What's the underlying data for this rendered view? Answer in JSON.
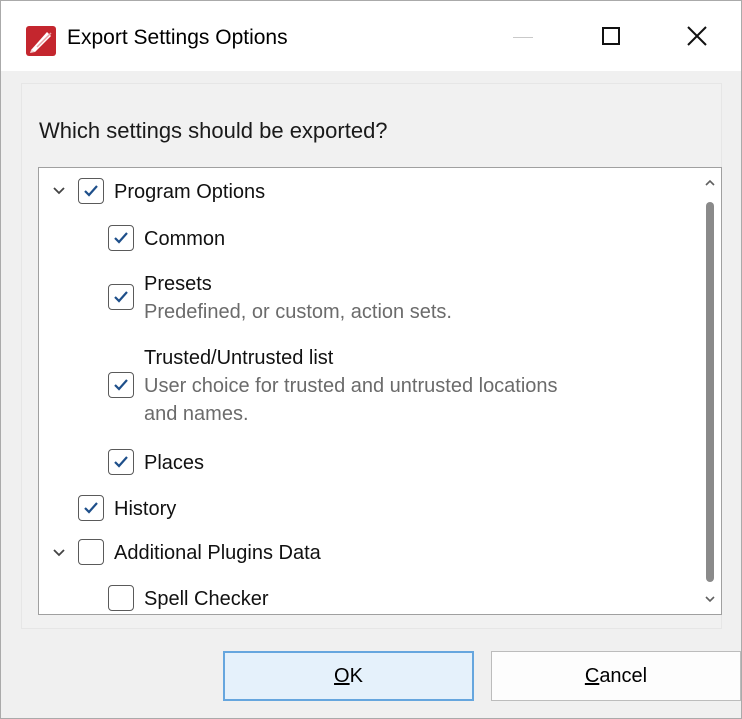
{
  "window": {
    "title": "Export Settings Options",
    "icons": {
      "app": "pdf-editor-app-icon",
      "minimize": "minimize-icon",
      "maximize": "maximize-icon",
      "close": "close-icon"
    }
  },
  "prompt": "Which settings should be exported?",
  "tree": {
    "program_options": {
      "label": "Program Options",
      "checked": true,
      "expanded": true
    },
    "common": {
      "label": "Common",
      "checked": true
    },
    "presets": {
      "label": "Presets",
      "desc": "Predefined, or custom, action sets.",
      "checked": true
    },
    "trusted": {
      "label": "Trusted/Untrusted list",
      "desc_line1": "User choice for trusted and untrusted locations",
      "desc_line2": "and names.",
      "checked": true
    },
    "places": {
      "label": "Places",
      "checked": true
    },
    "history": {
      "label": "History",
      "checked": true
    },
    "additional": {
      "label": "Additional Plugins Data",
      "checked": false,
      "expanded": true
    },
    "spell": {
      "label": "Spell Checker",
      "checked": false
    }
  },
  "buttons": {
    "ok": {
      "access_key": "O",
      "rest": "K"
    },
    "cancel": {
      "access_key": "C",
      "rest": "ancel"
    }
  },
  "colors": {
    "checkbox_check": "#1e4f8a",
    "ok_border": "#66a6de",
    "ok_fill": "#e5f1fb",
    "app_icon_red": "#c4262e"
  }
}
